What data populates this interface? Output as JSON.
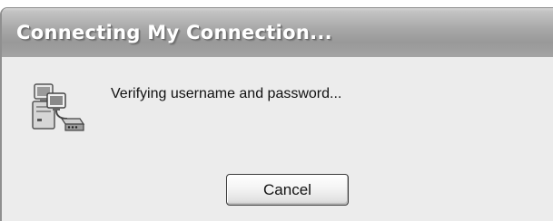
{
  "window": {
    "title": "Connecting My Connection..."
  },
  "dialog": {
    "icon": "network-connection-icon",
    "message": "Verifying username and password...",
    "cancel_label": "Cancel"
  }
}
